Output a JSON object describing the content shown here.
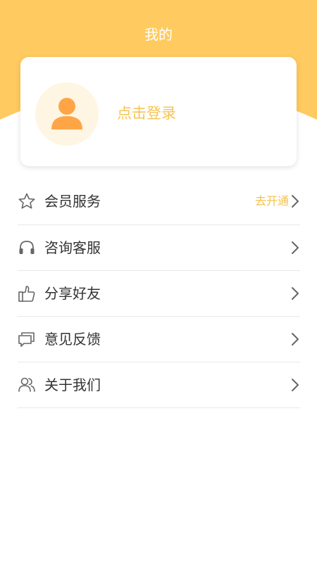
{
  "page": {
    "title": "我的"
  },
  "colors": {
    "header": "#ffcb60",
    "accent": "#f6c454",
    "avatar_bg": "#fff5e3",
    "avatar_icon": "#ffa545"
  },
  "profile": {
    "login_label": "点击登录",
    "avatar_icon": "user-avatar-icon"
  },
  "menu": {
    "items": [
      {
        "label": "会员服务",
        "icon": "star-icon",
        "extra": "去开通"
      },
      {
        "label": "咨询客服",
        "icon": "headset-icon"
      },
      {
        "label": "分享好友",
        "icon": "thumbs-up-icon"
      },
      {
        "label": "意见反馈",
        "icon": "chat-icon"
      },
      {
        "label": "关于我们",
        "icon": "users-icon"
      }
    ]
  }
}
